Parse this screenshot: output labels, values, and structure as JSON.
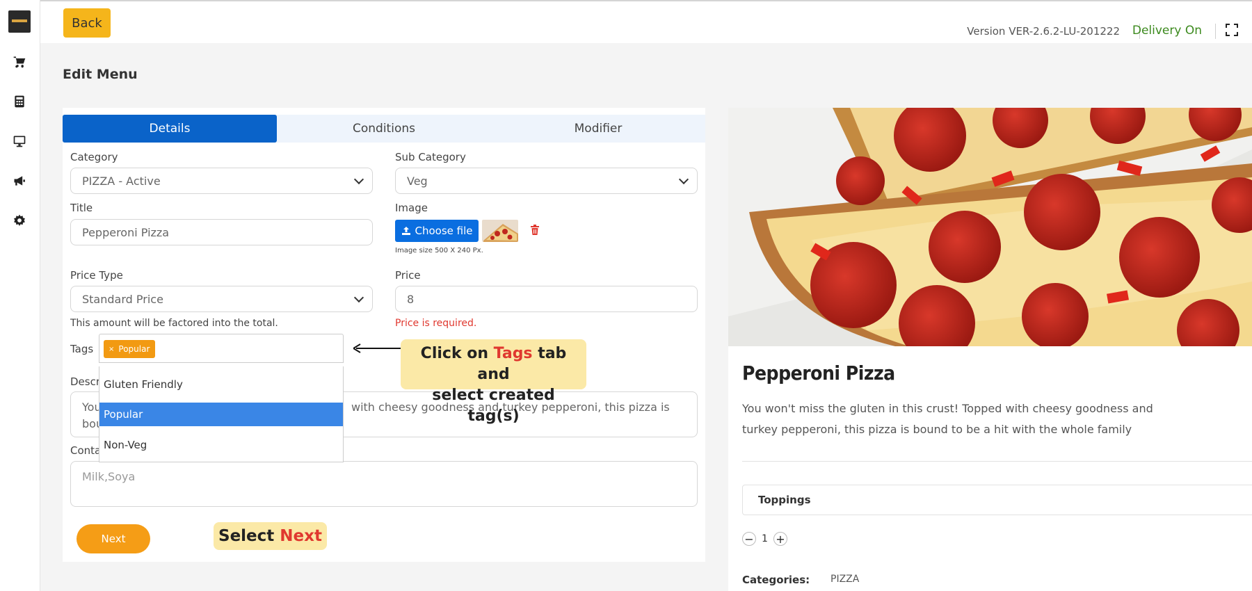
{
  "sidebar": {
    "icons": [
      "cart-icon",
      "calculator-icon",
      "monitor-icon",
      "megaphone-icon",
      "gear-icon"
    ]
  },
  "header": {
    "back_label": "Back",
    "version": "Version VER-2.6.2-LU-201222",
    "delivery_status": "Delivery On"
  },
  "page_title": "Edit Menu",
  "tabs": [
    {
      "label": "Details",
      "active": true
    },
    {
      "label": "Conditions",
      "active": false
    },
    {
      "label": "Modifier",
      "active": false
    }
  ],
  "form": {
    "category_label": "Category",
    "category_value": "PIZZA - Active",
    "subcategory_label": "Sub Category",
    "subcategory_value": "Veg",
    "title_label": "Title",
    "title_value": "Pepperoni Pizza",
    "image_label": "Image",
    "choose_file_label": "Choose file",
    "image_note": "Image size 500 X 240 Px.",
    "price_type_label": "Price Type",
    "price_type_value": "Standard Price",
    "price_type_helper": "This amount will be factored into the total.",
    "price_label": "Price",
    "price_value": "8",
    "price_error": "Price is required.",
    "tags_label": "Tags",
    "selected_tag": "Popular",
    "tag_options": [
      {
        "label": "Gluten Friendly",
        "selected": false
      },
      {
        "label": "Popular",
        "selected": true
      },
      {
        "label": "Non-Veg",
        "selected": false
      }
    ],
    "description_label_partial": "Descr",
    "description_visible_left": "You",
    "description_visible_left2": "bou",
    "description_visible_right": "with cheesy goodness and turkey pepperoni, this pizza is",
    "contains_label_partial": "Conta",
    "contains_placeholder": "Milk,Soya",
    "next_label": "Next"
  },
  "annotations": {
    "tags_callout": {
      "pre": "Click on ",
      "highlight": "Tags",
      "post": " tab and",
      "line2": "select created tag(s)"
    },
    "next_callout": {
      "pre": "Select ",
      "highlight": "Next"
    }
  },
  "preview": {
    "title": "Pepperoni Pizza",
    "description": "You won't miss the gluten in this crust! Topped with cheesy goodness and turkey pepperoni, this pizza is bound to be a hit with the whole family",
    "toppings_label": "Toppings",
    "quantity": "1",
    "categories_label": "Categories:",
    "categories_value": "PIZZA"
  },
  "colors": {
    "accent_blue": "#0a63c9",
    "accent_yellow": "#f5b51b",
    "next_orange": "#f59d16",
    "error_red": "#e0382f",
    "delivery_green": "#3c8a1e"
  }
}
